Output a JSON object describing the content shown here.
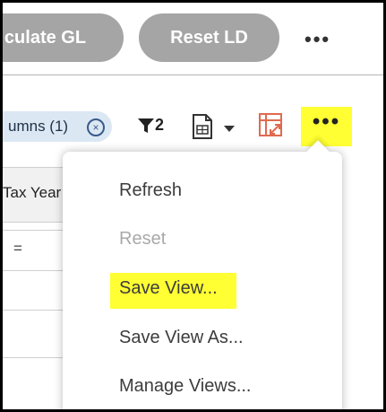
{
  "toolbar_top": {
    "calculate_label": "culate GL",
    "reset_label": "Reset LD",
    "more_label": "•••"
  },
  "grid_toolbar": {
    "columns_chip_label": "umns (1)",
    "columns_chip_close": "×",
    "filter_count": "2",
    "more_label": "•••"
  },
  "grid": {
    "column_header": "Tax Year",
    "first_row_value": "="
  },
  "menu": {
    "items": [
      {
        "label": "Refresh",
        "disabled": false
      },
      {
        "label": "Reset",
        "disabled": true
      },
      {
        "label": "Save View...",
        "disabled": false,
        "highlighted": true
      },
      {
        "label": "Save View As...",
        "disabled": false
      },
      {
        "label": "Manage Views...",
        "disabled": false
      }
    ]
  },
  "colors": {
    "pill_bg": "#a5a5a5",
    "chip_bg": "#dbe8f3",
    "highlight": "#ffff33",
    "pivot_icon": "#e06a50",
    "disabled_text": "#a9a9a9"
  }
}
